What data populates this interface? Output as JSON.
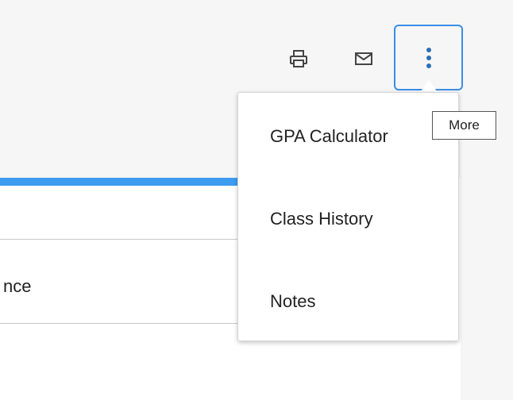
{
  "toolbar": {
    "print_icon": "printer-icon",
    "email_icon": "envelope-icon",
    "more_icon": "vertical-ellipsis-icon",
    "accent_color": "#3a8ee6"
  },
  "menu": {
    "items": [
      {
        "label": "GPA Calculator"
      },
      {
        "label": "Class History"
      },
      {
        "label": "Notes"
      }
    ]
  },
  "tooltip": {
    "text": "More"
  },
  "panel": {
    "header_color": "#3d9bf0",
    "cell_text": "nce"
  }
}
